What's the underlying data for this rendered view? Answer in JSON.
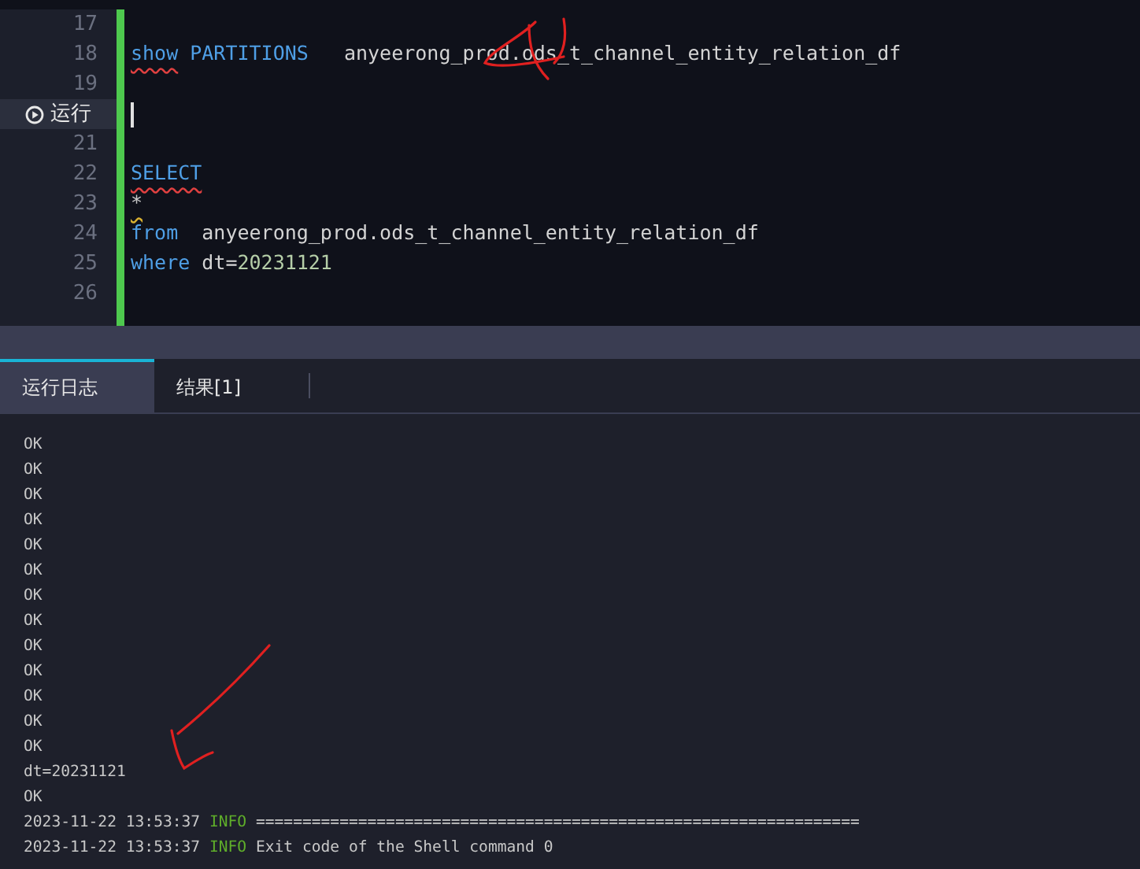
{
  "editor": {
    "lines": [
      {
        "kind": "code",
        "number": "17"
      },
      {
        "kind": "code",
        "number": "18",
        "tokens": [
          {
            "text": "show",
            "kind": "keyword",
            "error": true
          },
          {
            "text": " PARTITIONS",
            "kind": "keyword"
          },
          {
            "text": "   anyeerong_prod.ods_t_channel_entity_relation_df",
            "kind": "ident"
          }
        ]
      },
      {
        "kind": "code",
        "number": "19"
      },
      {
        "kind": "run",
        "label": "运行",
        "cursor": true
      },
      {
        "kind": "code",
        "number": "21"
      },
      {
        "kind": "code",
        "number": "22",
        "tokens": [
          {
            "text": "SELECT",
            "kind": "keyword",
            "error": true
          }
        ]
      },
      {
        "kind": "code",
        "number": "23",
        "tokens": [
          {
            "text": "*",
            "kind": "operator",
            "warning": true
          }
        ]
      },
      {
        "kind": "code",
        "number": "24",
        "tokens": [
          {
            "text": "from",
            "kind": "keyword"
          },
          {
            "text": "  anyeerong_prod.ods_t_channel_entity_relation_df",
            "kind": "ident"
          }
        ]
      },
      {
        "kind": "code",
        "number": "25",
        "tokens": [
          {
            "text": "where",
            "kind": "keyword"
          },
          {
            "text": " dt=",
            "kind": "ident"
          },
          {
            "text": "20231121",
            "kind": "number"
          }
        ]
      },
      {
        "kind": "code",
        "number": "26"
      }
    ]
  },
  "tabs": [
    {
      "label": "运行日志",
      "selected": true
    },
    {
      "label": "结果[1]",
      "selected": false
    }
  ],
  "log": [
    {
      "kind": "plain",
      "text": "OK"
    },
    {
      "kind": "plain",
      "text": "OK"
    },
    {
      "kind": "plain",
      "text": "OK"
    },
    {
      "kind": "plain",
      "text": "OK"
    },
    {
      "kind": "plain",
      "text": "OK"
    },
    {
      "kind": "plain",
      "text": "OK"
    },
    {
      "kind": "plain",
      "text": "OK"
    },
    {
      "kind": "plain",
      "text": "OK"
    },
    {
      "kind": "plain",
      "text": "OK"
    },
    {
      "kind": "plain",
      "text": "OK"
    },
    {
      "kind": "plain",
      "text": "OK"
    },
    {
      "kind": "plain",
      "text": "OK"
    },
    {
      "kind": "plain",
      "text": "OK"
    },
    {
      "kind": "plain",
      "text": "dt=20231121"
    },
    {
      "kind": "plain",
      "text": "OK"
    },
    {
      "kind": "entry",
      "time": "2023-11-22 13:53:37",
      "level": "INFO",
      "message": "================================================================="
    },
    {
      "kind": "entry",
      "time": "2023-11-22 13:53:37",
      "level": "INFO",
      "message": "Exit code of the Shell command 0"
    }
  ]
}
